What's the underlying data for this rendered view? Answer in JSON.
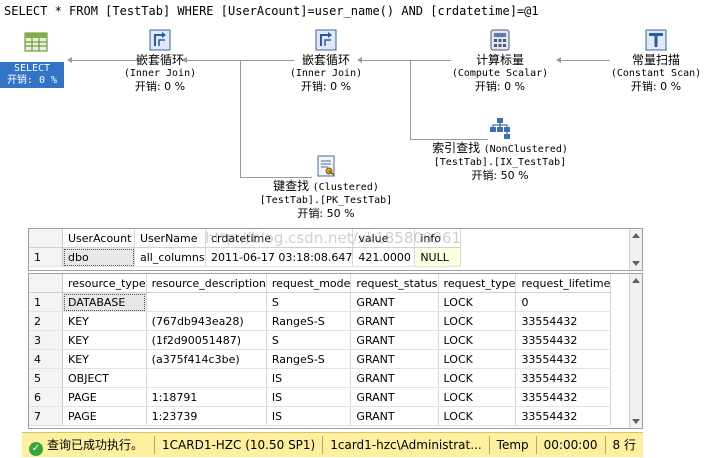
{
  "query": "SELECT * FROM [TestTab] WHERE [UserAcount]=user_name() AND [crdatetime]=@1",
  "plan": {
    "select": {
      "name": "SELECT",
      "cost": "开销: 0 %"
    },
    "nodes": [
      {
        "id": "nested-loop-1",
        "name": "嵌套循环",
        "sub": "(Inner Join)",
        "cost": "开销: 0 %",
        "icon": "nested-loops-icon"
      },
      {
        "id": "nested-loop-2",
        "name": "嵌套循环",
        "sub": "(Inner Join)",
        "cost": "开销: 0 %",
        "icon": "nested-loops-icon"
      },
      {
        "id": "compute-scalar",
        "name": "计算标量",
        "sub": "(Compute Scalar)",
        "cost": "开销: 0 %",
        "icon": "compute-scalar-icon"
      },
      {
        "id": "constant-scan",
        "name": "常量扫描",
        "sub": "(Constant Scan)",
        "cost": "开销: 0 %",
        "icon": "constant-scan-icon"
      },
      {
        "id": "index-seek",
        "name": "索引查找",
        "sub": "(NonClustered)",
        "sub2": "[TestTab].[IX_TestTab]",
        "cost": "开销: 50 %",
        "icon": "index-seek-icon"
      },
      {
        "id": "key-lookup",
        "name": "键查找",
        "sub": "(Clustered)",
        "sub2": "[TestTab].[PK_TestTab]",
        "cost": "开销: 50 %",
        "icon": "key-lookup-icon"
      }
    ]
  },
  "grid1": {
    "columns": [
      "UserAcount",
      "UserName",
      "crdatetime",
      "value",
      "info"
    ],
    "rows": [
      {
        "n": "1",
        "cells": [
          "dbo",
          "all_columns",
          "2011-06-17 03:18:08.647",
          "421.0000",
          "NULL"
        ]
      }
    ]
  },
  "grid2": {
    "columns": [
      "resource_type",
      "resource_description",
      "request_mode",
      "request_status",
      "request_type",
      "request_lifetime"
    ],
    "rows": [
      {
        "n": "1",
        "cells": [
          "DATABASE",
          "",
          "S",
          "GRANT",
          "LOCK",
          "0"
        ]
      },
      {
        "n": "2",
        "cells": [
          "KEY",
          "(767db943ea28)",
          "RangeS-S",
          "GRANT",
          "LOCK",
          "33554432"
        ]
      },
      {
        "n": "3",
        "cells": [
          "KEY",
          "(1f2d90051487)",
          "S",
          "GRANT",
          "LOCK",
          "33554432"
        ]
      },
      {
        "n": "4",
        "cells": [
          "KEY",
          "(a375f414c3be)",
          "RangeS-S",
          "GRANT",
          "LOCK",
          "33554432"
        ]
      },
      {
        "n": "5",
        "cells": [
          "OBJECT",
          "",
          "IS",
          "GRANT",
          "LOCK",
          "33554432"
        ]
      },
      {
        "n": "6",
        "cells": [
          "PAGE",
          "1:18791",
          "IS",
          "GRANT",
          "LOCK",
          "33554432"
        ]
      },
      {
        "n": "7",
        "cells": [
          "PAGE",
          "1:23739",
          "IS",
          "GRANT",
          "LOCK",
          "33554432"
        ]
      }
    ]
  },
  "watermark": "http://blog.csdn.net/xk185800961",
  "status": {
    "message": "查询已成功执行。",
    "server": "1CARD1-HZC (10.50 SP1)",
    "user": "1card1-hzc\\Administrat...",
    "database": "Temp",
    "elapsed": "00:00:00",
    "rows": "8 行"
  },
  "colors": {
    "select_bg": "#3275c8",
    "status_bg": "#fff0a0",
    "null_bg": "#ffffe1"
  }
}
